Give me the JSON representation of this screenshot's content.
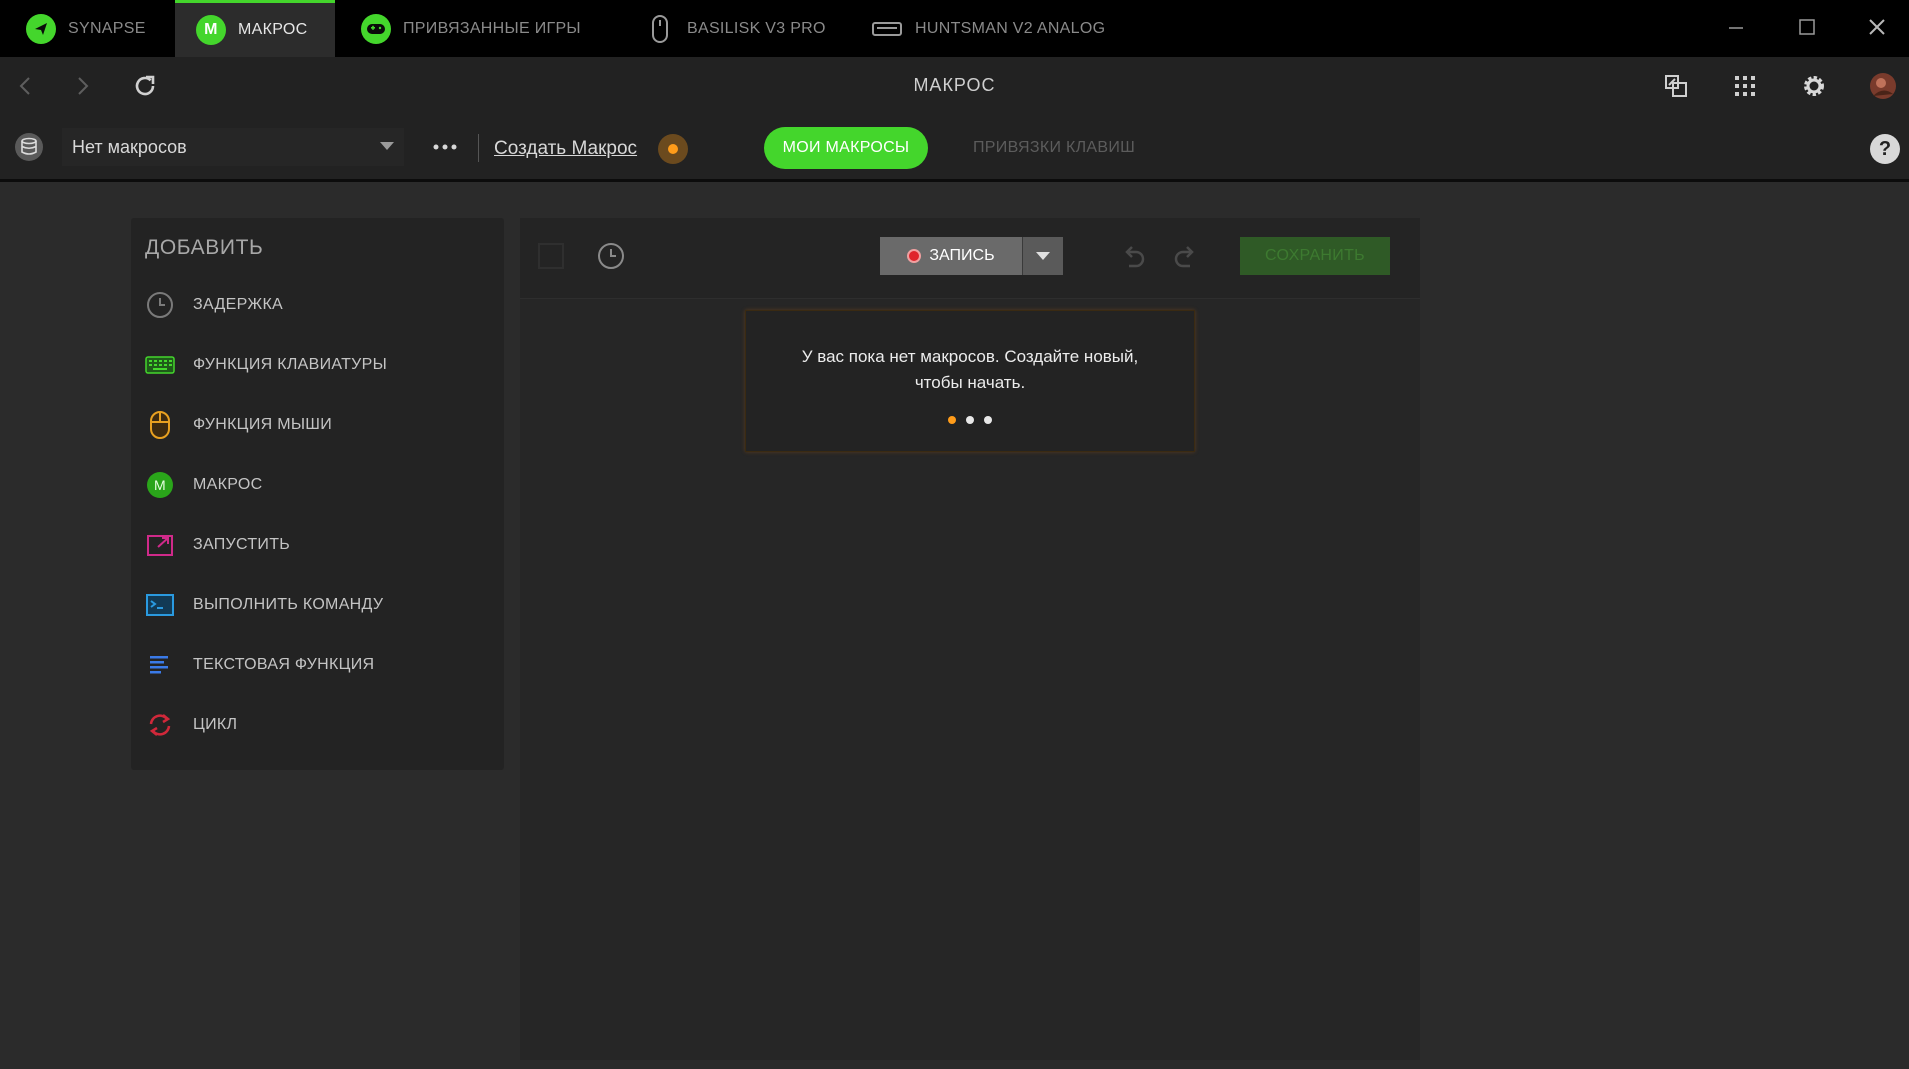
{
  "tabs": [
    {
      "label": "SYNAPSE",
      "icon": "razer-synapse-icon"
    },
    {
      "label": "МАКРОС",
      "icon": "macro-m-icon",
      "active": true
    },
    {
      "label": "ПРИВЯЗАННЫЕ ИГРЫ",
      "icon": "gamepad-icon"
    },
    {
      "label": "BASILISK V3 PRO",
      "icon": "mouse-icon"
    },
    {
      "label": "HUNTSMAN V2 ANALOG",
      "icon": "keyboard-icon"
    }
  ],
  "nav": {
    "title": "МАКРОС"
  },
  "toolbar": {
    "macro_select_value": "Нет макросов",
    "create_link": "Создать Макрос",
    "tab_my_macros": "МОИ МАКРОСЫ",
    "tab_key_bindings": "ПРИВЯЗКИ КЛАВИШ",
    "help": "?"
  },
  "add_panel": {
    "title": "ДОБАВИТЬ",
    "items": [
      {
        "label": "ЗАДЕРЖКА",
        "icon": "clock-icon"
      },
      {
        "label": "ФУНКЦИЯ КЛАВИАТУРЫ",
        "icon": "keyboard-icon"
      },
      {
        "label": "ФУНКЦИЯ МЫШИ",
        "icon": "mouse-icon"
      },
      {
        "label": "МАКРОС",
        "icon": "macro-m-icon"
      },
      {
        "label": "ЗАПУСТИТЬ",
        "icon": "launch-icon"
      },
      {
        "label": "ВЫПОЛНИТЬ КОМАНДУ",
        "icon": "terminal-icon"
      },
      {
        "label": "ТЕКСТОВАЯ ФУНКЦИЯ",
        "icon": "text-lines-icon"
      },
      {
        "label": "ЦИКЛ",
        "icon": "loop-icon"
      }
    ]
  },
  "editor": {
    "record_label": "ЗАПИСЬ",
    "save_label": "СОХРАНИТЬ",
    "empty_message": "У вас пока нет макросов. Создайте новый, чтобы начать."
  },
  "colors": {
    "accent": "#44d62c",
    "record": "#e0242c",
    "notify": "#ff9c1a"
  }
}
